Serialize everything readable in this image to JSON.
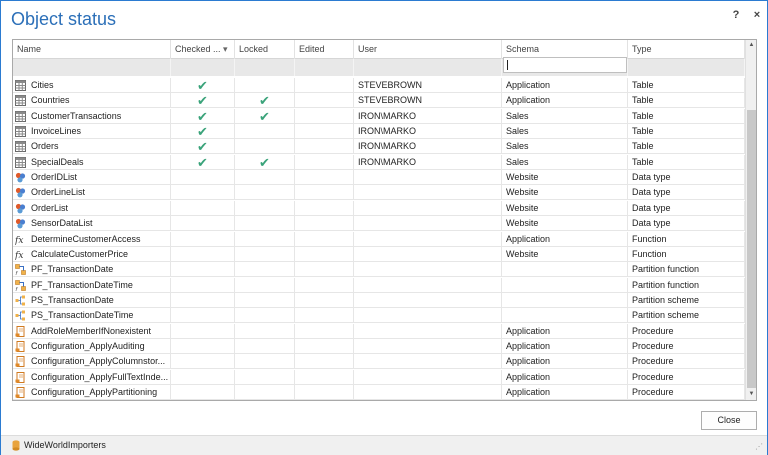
{
  "window": {
    "title": "Object status",
    "help_label": "?",
    "close_label": "×"
  },
  "columns": [
    {
      "key": "name",
      "label": "Name"
    },
    {
      "key": "checked",
      "label": "Checked ...",
      "sort": "chevron-down-icon"
    },
    {
      "key": "locked",
      "label": "Locked"
    },
    {
      "key": "edited",
      "label": "Edited"
    },
    {
      "key": "user",
      "label": "User"
    },
    {
      "key": "schema",
      "label": "Schema"
    },
    {
      "key": "type",
      "label": "Type"
    }
  ],
  "filter": {
    "schema_value": ""
  },
  "rows": [
    {
      "name": "Cities",
      "icon": "table-icon",
      "checked": true,
      "locked": false,
      "edited": false,
      "user": "STEVEBROWN",
      "schema": "Application",
      "type": "Table"
    },
    {
      "name": "Countries",
      "icon": "table-icon",
      "checked": true,
      "locked": true,
      "edited": false,
      "user": "STEVEBROWN",
      "schema": "Application",
      "type": "Table"
    },
    {
      "name": "CustomerTransactions",
      "icon": "table-icon",
      "checked": true,
      "locked": true,
      "edited": false,
      "user": "IRON\\MARKO",
      "schema": "Sales",
      "type": "Table"
    },
    {
      "name": "InvoiceLines",
      "icon": "table-icon",
      "checked": true,
      "locked": false,
      "edited": false,
      "user": "IRON\\MARKO",
      "schema": "Sales",
      "type": "Table"
    },
    {
      "name": "Orders",
      "icon": "table-icon",
      "checked": true,
      "locked": false,
      "edited": false,
      "user": "IRON\\MARKO",
      "schema": "Sales",
      "type": "Table"
    },
    {
      "name": "SpecialDeals",
      "icon": "table-icon",
      "checked": true,
      "locked": true,
      "edited": false,
      "user": "IRON\\MARKO",
      "schema": "Sales",
      "type": "Table"
    },
    {
      "name": "OrderIDList",
      "icon": "data-type-icon",
      "checked": false,
      "locked": false,
      "edited": false,
      "user": "",
      "schema": "Website",
      "type": "Data type"
    },
    {
      "name": "OrderLineList",
      "icon": "data-type-icon",
      "checked": false,
      "locked": false,
      "edited": false,
      "user": "",
      "schema": "Website",
      "type": "Data type"
    },
    {
      "name": "OrderList",
      "icon": "data-type-icon",
      "checked": false,
      "locked": false,
      "edited": false,
      "user": "",
      "schema": "Website",
      "type": "Data type"
    },
    {
      "name": "SensorDataList",
      "icon": "data-type-icon",
      "checked": false,
      "locked": false,
      "edited": false,
      "user": "",
      "schema": "Website",
      "type": "Data type"
    },
    {
      "name": "DetermineCustomerAccess",
      "icon": "function-icon",
      "checked": false,
      "locked": false,
      "edited": false,
      "user": "",
      "schema": "Application",
      "type": "Function"
    },
    {
      "name": "CalculateCustomerPrice",
      "icon": "function-icon",
      "checked": false,
      "locked": false,
      "edited": false,
      "user": "",
      "schema": "Website",
      "type": "Function"
    },
    {
      "name": "PF_TransactionDate",
      "icon": "partition-function-icon",
      "checked": false,
      "locked": false,
      "edited": false,
      "user": "",
      "schema": "",
      "type": "Partition function"
    },
    {
      "name": "PF_TransactionDateTime",
      "icon": "partition-function-icon",
      "checked": false,
      "locked": false,
      "edited": false,
      "user": "",
      "schema": "",
      "type": "Partition function"
    },
    {
      "name": "PS_TransactionDate",
      "icon": "partition-scheme-icon",
      "checked": false,
      "locked": false,
      "edited": false,
      "user": "",
      "schema": "",
      "type": "Partition scheme"
    },
    {
      "name": "PS_TransactionDateTime",
      "icon": "partition-scheme-icon",
      "checked": false,
      "locked": false,
      "edited": false,
      "user": "",
      "schema": "",
      "type": "Partition scheme"
    },
    {
      "name": "AddRoleMemberIfNonexistent",
      "icon": "procedure-icon",
      "checked": false,
      "locked": false,
      "edited": false,
      "user": "",
      "schema": "Application",
      "type": "Procedure"
    },
    {
      "name": "Configuration_ApplyAuditing",
      "icon": "procedure-icon",
      "checked": false,
      "locked": false,
      "edited": false,
      "user": "",
      "schema": "Application",
      "type": "Procedure"
    },
    {
      "name": "Configuration_ApplyColumnstor...",
      "icon": "procedure-icon",
      "checked": false,
      "locked": false,
      "edited": false,
      "user": "",
      "schema": "Application",
      "type": "Procedure"
    },
    {
      "name": "Configuration_ApplyFullTextInde...",
      "icon": "procedure-icon",
      "checked": false,
      "locked": false,
      "edited": false,
      "user": "",
      "schema": "Application",
      "type": "Procedure"
    },
    {
      "name": "Configuration_ApplyPartitioning",
      "icon": "procedure-icon",
      "checked": false,
      "locked": false,
      "edited": false,
      "user": "",
      "schema": "Application",
      "type": "Procedure"
    }
  ],
  "check_glyph": "✔",
  "footer": {
    "close_label": "Close"
  },
  "statusbar": {
    "database": "WideWorldImporters",
    "icon": "database-icon"
  },
  "colors": {
    "accent": "#2b6fb8",
    "check": "#3aa37a"
  }
}
